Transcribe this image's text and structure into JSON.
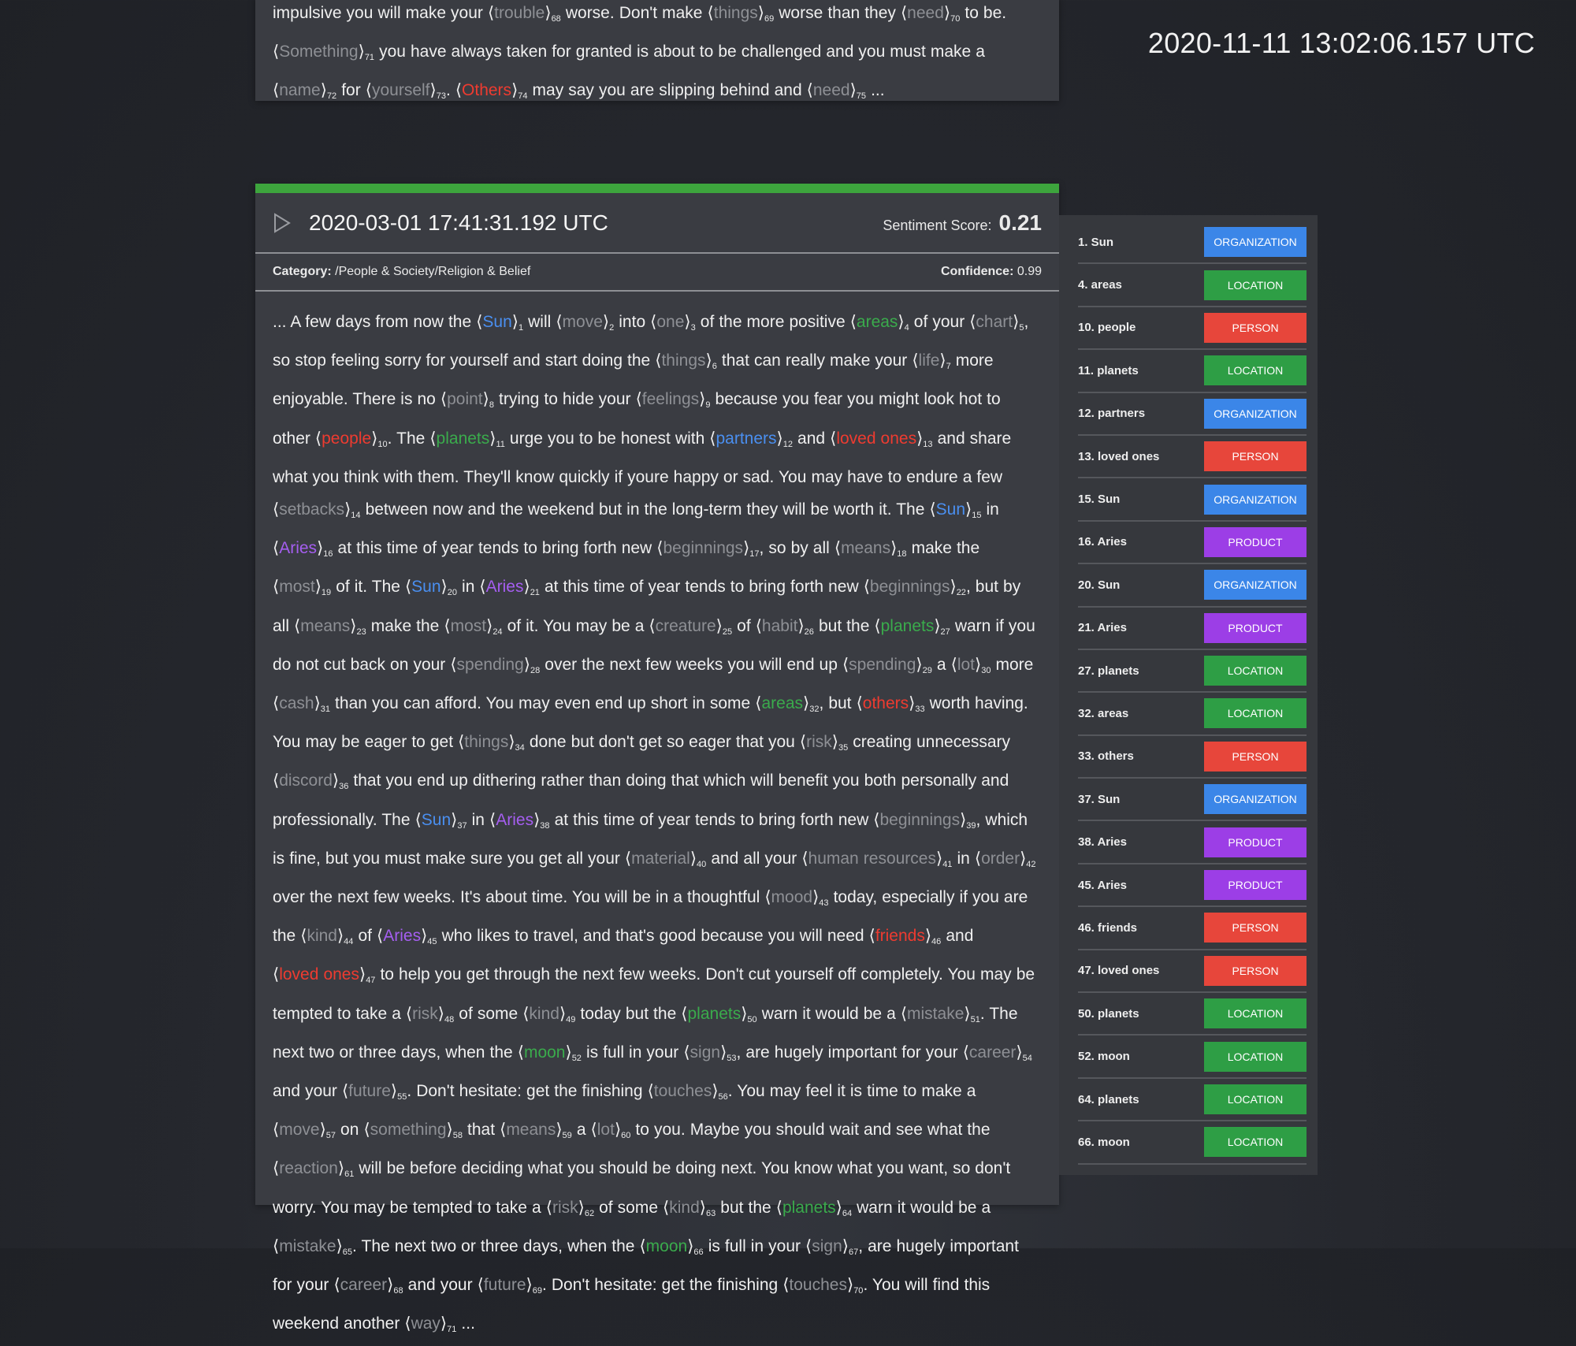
{
  "header": {
    "clock": "2020-11-11 13:02:06.157 UTC"
  },
  "colors": {
    "grey": "#8e9095",
    "blue": "#4a8ff0",
    "green": "#3aab4c",
    "red": "#ee3b30",
    "purple": "#a55ef0",
    "sentiment_bar": "#3da53d"
  },
  "previous_entry": {
    "segments": [
      {
        "t": "impulsive you will make your "
      },
      {
        "e": "trouble",
        "n": "68",
        "c": "grey"
      },
      {
        "t": " worse. Don't make "
      },
      {
        "e": "things",
        "n": "69",
        "c": "grey"
      },
      {
        "t": " worse than they "
      },
      {
        "e": "need",
        "n": "70",
        "c": "grey"
      },
      {
        "t": " to be. "
      },
      {
        "e": "Something",
        "n": "71",
        "c": "grey"
      },
      {
        "t": " you have always taken for granted is about to be challenged and you must make a "
      },
      {
        "e": "name",
        "n": "72",
        "c": "grey"
      },
      {
        "t": " for "
      },
      {
        "e": "yourself",
        "n": "73",
        "c": "grey"
      },
      {
        "t": ". "
      },
      {
        "e": "Others",
        "n": "74",
        "c": "red"
      },
      {
        "t": " may say you are slipping behind and "
      },
      {
        "e": "need",
        "n": "75",
        "c": "grey"
      },
      {
        "t": " ..."
      }
    ]
  },
  "entry": {
    "timestamp": "2020-03-01 17:41:31.192 UTC",
    "sentiment_label": "Sentiment Score:",
    "sentiment_value": "0.21",
    "category_label": "Category:",
    "category_value": "/People & Society/Religion & Belief",
    "confidence_label": "Confidence:",
    "confidence_value": "0.99",
    "segments": [
      {
        "t": "... A few days from now the "
      },
      {
        "e": "Sun",
        "n": "1",
        "c": "blue"
      },
      {
        "t": " will "
      },
      {
        "e": "move",
        "n": "2",
        "c": "grey"
      },
      {
        "t": " into "
      },
      {
        "e": "one",
        "n": "3",
        "c": "grey"
      },
      {
        "t": " of the more positive "
      },
      {
        "e": "areas",
        "n": "4",
        "c": "green"
      },
      {
        "t": " of your "
      },
      {
        "e": "chart",
        "n": "5",
        "c": "grey"
      },
      {
        "t": ", so stop feeling sorry for yourself and start doing the "
      },
      {
        "e": "things",
        "n": "6",
        "c": "grey"
      },
      {
        "t": " that can really make your "
      },
      {
        "e": "life",
        "n": "7",
        "c": "grey"
      },
      {
        "t": " more enjoyable. There is no "
      },
      {
        "e": "point",
        "n": "8",
        "c": "grey"
      },
      {
        "t": " trying to hide your "
      },
      {
        "e": "feelings",
        "n": "9",
        "c": "grey"
      },
      {
        "t": " because you fear you might look hot to other "
      },
      {
        "e": "people",
        "n": "10",
        "c": "red"
      },
      {
        "t": ". The "
      },
      {
        "e": "planets",
        "n": "11",
        "c": "green"
      },
      {
        "t": " urge you to be honest with "
      },
      {
        "e": "partners",
        "n": "12",
        "c": "blue"
      },
      {
        "t": " and "
      },
      {
        "e": "loved ones",
        "n": "13",
        "c": "red"
      },
      {
        "t": " and share what you think with them. They'll know quickly if youre happy or sad. You may have to endure a few "
      },
      {
        "e": "setbacks",
        "n": "14",
        "c": "grey"
      },
      {
        "t": " between now and the weekend but in the long-term they will be worth it. The "
      },
      {
        "e": "Sun",
        "n": "15",
        "c": "blue"
      },
      {
        "t": " in "
      },
      {
        "e": "Aries",
        "n": "16",
        "c": "purple"
      },
      {
        "t": " at this time of year tends to bring forth new "
      },
      {
        "e": "beginnings",
        "n": "17",
        "c": "grey"
      },
      {
        "t": ", so by all "
      },
      {
        "e": "means",
        "n": "18",
        "c": "grey"
      },
      {
        "t": " make the "
      },
      {
        "e": "most",
        "n": "19",
        "c": "grey"
      },
      {
        "t": " of it. The "
      },
      {
        "e": "Sun",
        "n": "20",
        "c": "blue"
      },
      {
        "t": " in "
      },
      {
        "e": "Aries",
        "n": "21",
        "c": "purple"
      },
      {
        "t": " at this time of year tends to bring forth new "
      },
      {
        "e": "beginnings",
        "n": "22",
        "c": "grey"
      },
      {
        "t": ", but by all "
      },
      {
        "e": "means",
        "n": "23",
        "c": "grey"
      },
      {
        "t": " make the "
      },
      {
        "e": "most",
        "n": "24",
        "c": "grey"
      },
      {
        "t": " of it. You may be a "
      },
      {
        "e": "creature",
        "n": "25",
        "c": "grey"
      },
      {
        "t": " of "
      },
      {
        "e": "habit",
        "n": "26",
        "c": "grey"
      },
      {
        "t": " but the "
      },
      {
        "e": "planets",
        "n": "27",
        "c": "green"
      },
      {
        "t": " warn if you do not cut back on your "
      },
      {
        "e": "spending",
        "n": "28",
        "c": "grey"
      },
      {
        "t": " over the next few weeks you will end up "
      },
      {
        "e": "spending",
        "n": "29",
        "c": "grey"
      },
      {
        "t": " a "
      },
      {
        "e": "lot",
        "n": "30",
        "c": "grey"
      },
      {
        "t": " more "
      },
      {
        "e": "cash",
        "n": "31",
        "c": "grey"
      },
      {
        "t": " than you can afford. You may even end up short in some "
      },
      {
        "e": "areas",
        "n": "32",
        "c": "green"
      },
      {
        "t": ", but "
      },
      {
        "e": "others",
        "n": "33",
        "c": "red"
      },
      {
        "t": " worth having. You may be eager to get "
      },
      {
        "e": "things",
        "n": "34",
        "c": "grey"
      },
      {
        "t": " done but don't get so eager that you "
      },
      {
        "e": "risk",
        "n": "35",
        "c": "grey"
      },
      {
        "t": " creating unnecessary "
      },
      {
        "e": "discord",
        "n": "36",
        "c": "grey"
      },
      {
        "t": " that you end up dithering rather than doing that which will benefit you both personally and professionally. The "
      },
      {
        "e": "Sun",
        "n": "37",
        "c": "blue"
      },
      {
        "t": " in "
      },
      {
        "e": "Aries",
        "n": "38",
        "c": "purple"
      },
      {
        "t": " at this time of year tends to bring forth new "
      },
      {
        "e": "beginnings",
        "n": "39",
        "c": "grey"
      },
      {
        "t": ", which is fine, but you must make sure you get all your "
      },
      {
        "e": "material",
        "n": "40",
        "c": "grey"
      },
      {
        "t": " and all your "
      },
      {
        "e": "human resources",
        "n": "41",
        "c": "grey"
      },
      {
        "t": " in "
      },
      {
        "e": "order",
        "n": "42",
        "c": "grey"
      },
      {
        "t": " over the next few weeks. It's about time. You will be in a thoughtful "
      },
      {
        "e": "mood",
        "n": "43",
        "c": "grey"
      },
      {
        "t": " today, especially if you are the "
      },
      {
        "e": "kind",
        "n": "44",
        "c": "grey"
      },
      {
        "t": " of "
      },
      {
        "e": "Aries",
        "n": "45",
        "c": "purple"
      },
      {
        "t": " who likes to travel, and that's good because you will need "
      },
      {
        "e": "friends",
        "n": "46",
        "c": "red"
      },
      {
        "t": " and "
      },
      {
        "e": "loved ones",
        "n": "47",
        "c": "red"
      },
      {
        "t": " to help you get through the next few weeks. Don't cut yourself off completely. You may be tempted to take a "
      },
      {
        "e": "risk",
        "n": "48",
        "c": "grey"
      },
      {
        "t": " of some "
      },
      {
        "e": "kind",
        "n": "49",
        "c": "grey"
      },
      {
        "t": " today but the "
      },
      {
        "e": "planets",
        "n": "50",
        "c": "green"
      },
      {
        "t": " warn it would be a "
      },
      {
        "e": "mistake",
        "n": "51",
        "c": "grey"
      },
      {
        "t": ". The next two or three days, when the "
      },
      {
        "e": "moon",
        "n": "52",
        "c": "green"
      },
      {
        "t": " is full in your "
      },
      {
        "e": "sign",
        "n": "53",
        "c": "grey"
      },
      {
        "t": ", are hugely important for your "
      },
      {
        "e": "career",
        "n": "54",
        "c": "grey"
      },
      {
        "t": " and your "
      },
      {
        "e": "future",
        "n": "55",
        "c": "grey"
      },
      {
        "t": ". Don't hesitate: get the finishing "
      },
      {
        "e": "touches",
        "n": "56",
        "c": "grey"
      },
      {
        "t": ". You may feel it is time to make a "
      },
      {
        "e": "move",
        "n": "57",
        "c": "grey"
      },
      {
        "t": " on "
      },
      {
        "e": "something",
        "n": "58",
        "c": "grey"
      },
      {
        "t": " that "
      },
      {
        "e": "means",
        "n": "59",
        "c": "grey"
      },
      {
        "t": " a "
      },
      {
        "e": "lot",
        "n": "60",
        "c": "grey"
      },
      {
        "t": " to you. Maybe you should wait and see what the "
      },
      {
        "e": "reaction",
        "n": "61",
        "c": "grey"
      },
      {
        "t": " will be before deciding what you should be doing next. You know what you want, so don't worry. You may be tempted to take a "
      },
      {
        "e": "risk",
        "n": "62",
        "c": "grey"
      },
      {
        "t": " of some "
      },
      {
        "e": "kind",
        "n": "63",
        "c": "grey"
      },
      {
        "t": " but the "
      },
      {
        "e": "planets",
        "n": "64",
        "c": "green"
      },
      {
        "t": " warn it would be a "
      },
      {
        "e": "mistake",
        "n": "65",
        "c": "grey"
      },
      {
        "t": ". The next two or three days, when the "
      },
      {
        "e": "moon",
        "n": "66",
        "c": "green"
      },
      {
        "t": " is full in your "
      },
      {
        "e": "sign",
        "n": "67",
        "c": "grey"
      },
      {
        "t": ", are hugely important for your "
      },
      {
        "e": "career",
        "n": "68",
        "c": "grey"
      },
      {
        "t": " and your "
      },
      {
        "e": "future",
        "n": "69",
        "c": "grey"
      },
      {
        "t": ". Don't hesitate: get the finishing "
      },
      {
        "e": "touches",
        "n": "70",
        "c": "grey"
      },
      {
        "t": ". You will find this weekend another "
      },
      {
        "e": "way",
        "n": "71",
        "c": "grey"
      },
      {
        "t": " ..."
      }
    ]
  },
  "entities": [
    {
      "label": "1. Sun",
      "type": "ORGANIZATION",
      "color": "#3b86e8"
    },
    {
      "label": "4. areas",
      "type": "LOCATION",
      "color": "#2e9e45"
    },
    {
      "label": "10. people",
      "type": "PERSON",
      "color": "#e7463b"
    },
    {
      "label": "11. planets",
      "type": "LOCATION",
      "color": "#2e9e45"
    },
    {
      "label": "12. partners",
      "type": "ORGANIZATION",
      "color": "#3b86e8"
    },
    {
      "label": "13. loved ones",
      "type": "PERSON",
      "color": "#e7463b"
    },
    {
      "label": "15. Sun",
      "type": "ORGANIZATION",
      "color": "#3b86e8"
    },
    {
      "label": "16. Aries",
      "type": "PRODUCT",
      "color": "#9c3ee6"
    },
    {
      "label": "20. Sun",
      "type": "ORGANIZATION",
      "color": "#3b86e8"
    },
    {
      "label": "21. Aries",
      "type": "PRODUCT",
      "color": "#9c3ee6"
    },
    {
      "label": "27. planets",
      "type": "LOCATION",
      "color": "#2e9e45"
    },
    {
      "label": "32. areas",
      "type": "LOCATION",
      "color": "#2e9e45"
    },
    {
      "label": "33. others",
      "type": "PERSON",
      "color": "#e7463b"
    },
    {
      "label": "37. Sun",
      "type": "ORGANIZATION",
      "color": "#3b86e8"
    },
    {
      "label": "38. Aries",
      "type": "PRODUCT",
      "color": "#9c3ee6"
    },
    {
      "label": "45. Aries",
      "type": "PRODUCT",
      "color": "#9c3ee6"
    },
    {
      "label": "46. friends",
      "type": "PERSON",
      "color": "#e7463b"
    },
    {
      "label": "47. loved ones",
      "type": "PERSON",
      "color": "#e7463b"
    },
    {
      "label": "50. planets",
      "type": "LOCATION",
      "color": "#2e9e45"
    },
    {
      "label": "52. moon",
      "type": "LOCATION",
      "color": "#2e9e45"
    },
    {
      "label": "64. planets",
      "type": "LOCATION",
      "color": "#2e9e45"
    },
    {
      "label": "66. moon",
      "type": "LOCATION",
      "color": "#2e9e45"
    }
  ]
}
